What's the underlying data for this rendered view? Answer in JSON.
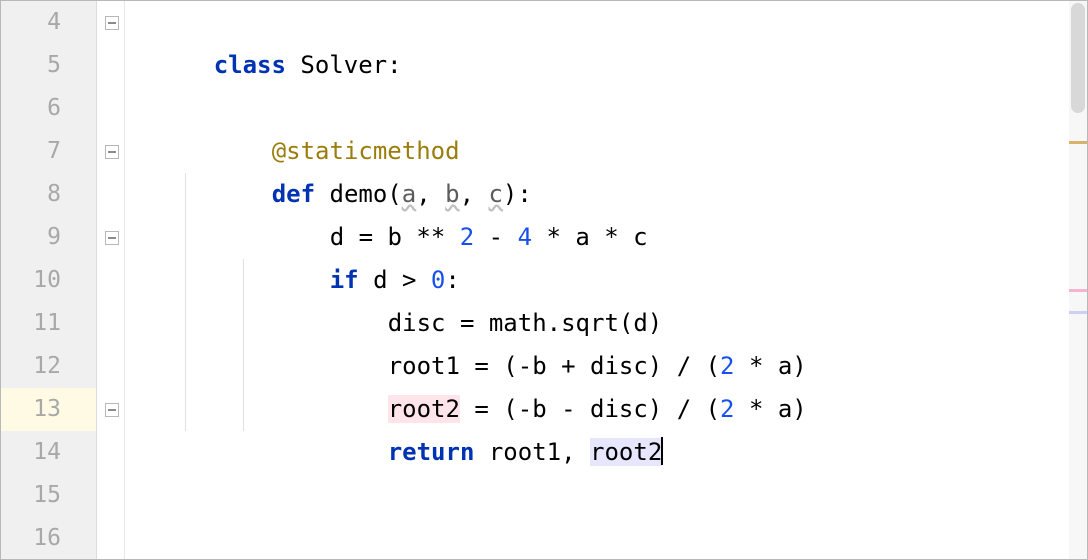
{
  "editor": {
    "first_line_number": 4,
    "current_line_number": 13,
    "lines": {
      "4": {
        "ln": "4"
      },
      "5": {
        "ln": "5"
      },
      "6": {
        "ln": "6",
        "decorator": "@staticmethod"
      },
      "7": {
        "ln": "7",
        "def": "def ",
        "name": "demo",
        "lp": "(",
        "a": "a",
        "c1": ", ",
        "b": "b",
        "c2": ", ",
        "c": "c",
        "rp": "):"
      },
      "8": {
        "ln": "8",
        "pre": "d = b ** ",
        "n1": "2",
        "mid": " - ",
        "n2": "4",
        "post": " * a * c"
      },
      "9": {
        "ln": "9",
        "if": "if ",
        "cond": "d > ",
        "zero": "0",
        "colon": ":"
      },
      "10": {
        "ln": "10",
        "text": "disc = math.sqrt(d)"
      },
      "11": {
        "ln": "11",
        "pre": "root1 = (-b + disc) / (",
        "n": "2",
        "post": " * a)"
      },
      "12": {
        "ln": "12",
        "hl": "root2",
        "mid": " = (-b - disc) / (",
        "n": "2",
        "post": " * a)"
      },
      "13": {
        "ln": "13",
        "ret": "return ",
        "r1": "root1, ",
        "hl": "root2"
      },
      "14": {
        "ln": "14"
      },
      "15": {
        "ln": "15"
      },
      "16": {
        "ln": "16"
      }
    },
    "tokens": {
      "class": "class ",
      "class_name": "Solver",
      "colon": ":"
    }
  },
  "scrollbar_marks": {
    "warn_color": "#d6b36a",
    "pink_color": "#f5b5d1",
    "lilac_color": "#cfcff5"
  }
}
